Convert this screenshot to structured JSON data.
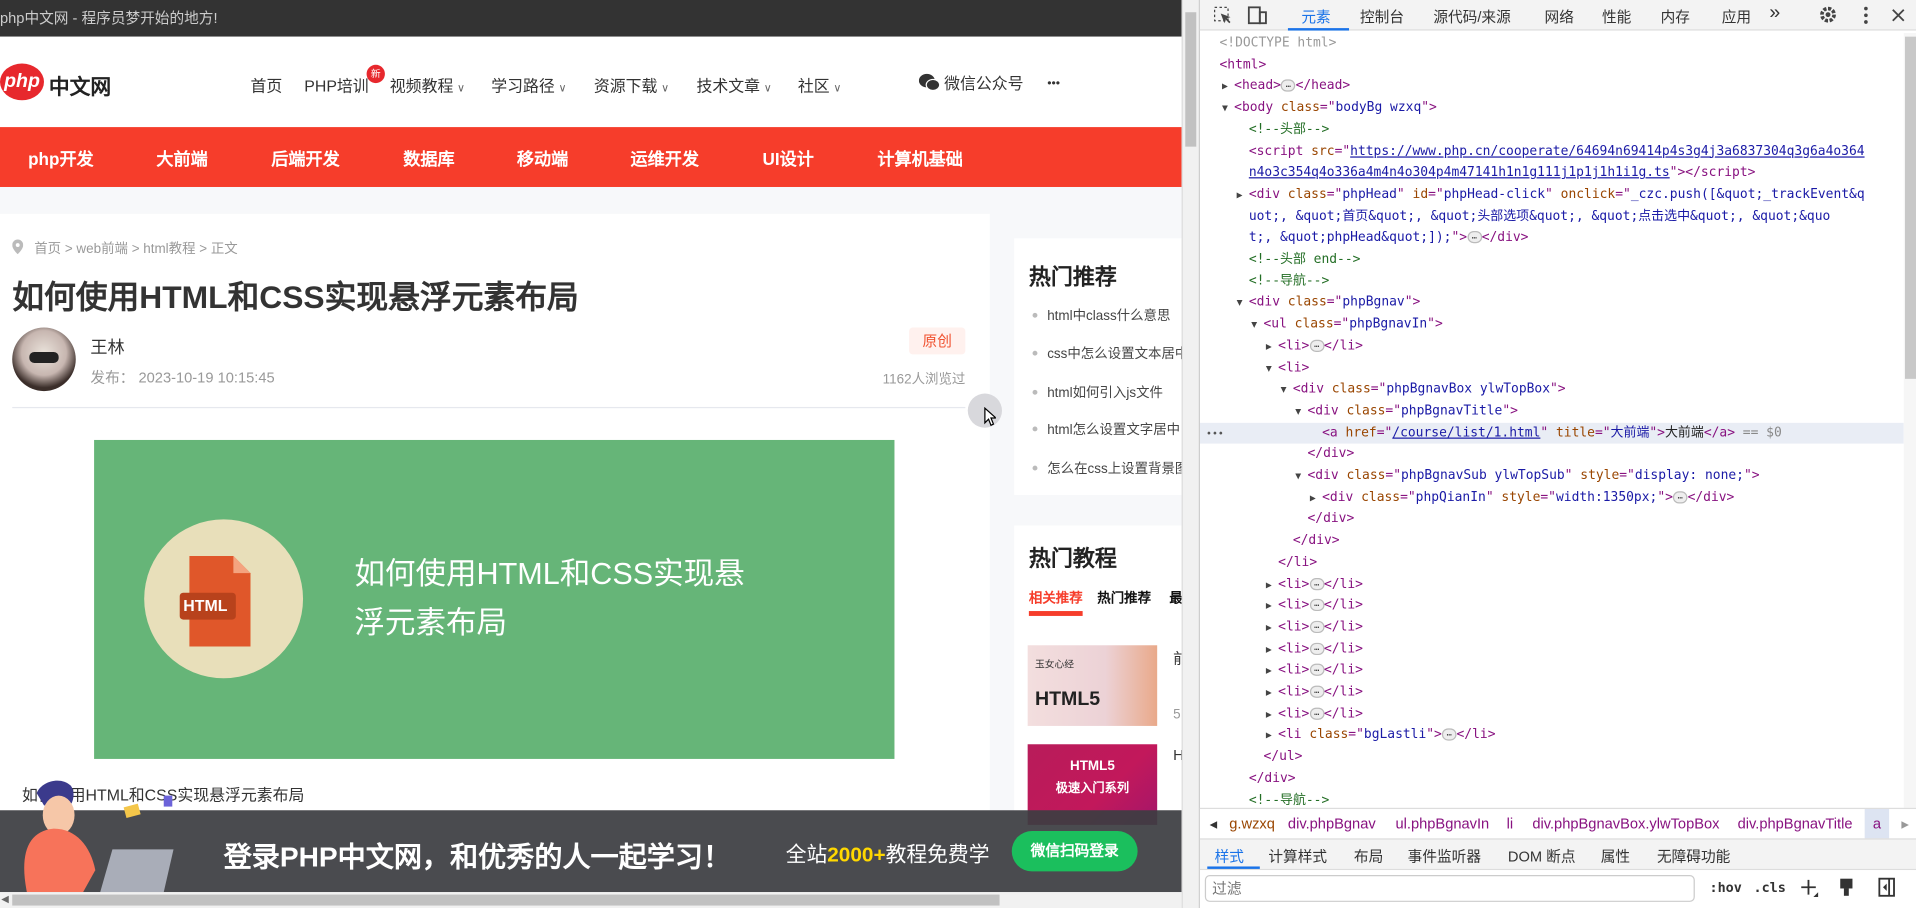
{
  "page": {
    "top_strip": "php中文网 - 程序员梦开始的地方!",
    "logo": {
      "mark": "php",
      "text": "中文网"
    },
    "nav": [
      {
        "label": "首页"
      },
      {
        "label": "PHP培训",
        "badge": "新"
      },
      {
        "label": "视频教程",
        "dropdown": true
      },
      {
        "label": "学习路径",
        "dropdown": true
      },
      {
        "label": "资源下载",
        "dropdown": true
      },
      {
        "label": "技术文章",
        "dropdown": true
      },
      {
        "label": "社区",
        "dropdown": true
      }
    ],
    "wechat": "微信公众号",
    "more": "•••",
    "dropdown_glyph": "∨",
    "category_nav": [
      "php开发",
      "大前端",
      "后端开发",
      "数据库",
      "移动端",
      "运维开发",
      "UI设计",
      "计算机基础"
    ],
    "breadcrumb": "首页 > web前端 > html教程 > 正文",
    "article": {
      "title": "如何使用HTML和CSS实现悬浮元素布局",
      "author": "王林",
      "published": "发布：  2023-10-19 10:15:45",
      "tag": "原创",
      "views": "1162人浏览过",
      "cover": {
        "icon_label": "HTML",
        "line1": "如何使用HTML和CSS实现悬",
        "line2": "浮元素布局"
      },
      "caption": "如何使用HTML和CSS实现悬浮元素布局"
    },
    "hot": {
      "title": "热门推荐",
      "items": [
        "html中class什么意思",
        "css中怎么设置文本居中",
        "html如何引入js文件",
        "html怎么设置文字居中",
        "怎么在css上设置背景图片"
      ]
    },
    "tutorials": {
      "title": "热门教程",
      "tabs": [
        "相关推荐",
        "热门推荐",
        "最"
      ],
      "cards": [
        {
          "thumb_title": "HTML5",
          "thumb_sub": "玉女心经",
          "title": "前",
          "meta": "5"
        },
        {
          "thumb_title": "HTML5",
          "thumb_sub": "极速入门系列",
          "title": "H"
        }
      ]
    },
    "banner": {
      "headline": "登录PHP中文网，和优秀的人一起学习！",
      "sub_pre": "全站",
      "sub_num": "2000+",
      "sub_post": "教程免费学",
      "button": "微信扫码登录"
    },
    "colors": {
      "brand_red": "#f63d2b",
      "green": "#1bbf5d",
      "yellow": "#ffd800"
    }
  },
  "devtools": {
    "tabs": [
      "元素",
      "控制台",
      "源代码/来源",
      "网络",
      "性能",
      "内存",
      "应用"
    ],
    "more_tabs": "»",
    "tree": [
      {
        "i": 0,
        "p": [
          [
            "dt",
            "<!DOCTYPE html>"
          ]
        ]
      },
      {
        "i": 0,
        "p": [
          [
            "tag",
            "<html>"
          ]
        ]
      },
      {
        "i": 1,
        "a": "r",
        "p": [
          [
            "tag",
            "<head>"
          ],
          [
            "ell",
            "…"
          ],
          [
            "tag",
            "</head>"
          ]
        ]
      },
      {
        "i": 1,
        "a": "d",
        "p": [
          [
            "tag",
            "<body "
          ],
          [
            "an",
            "class"
          ],
          [
            "tag",
            "=\""
          ],
          [
            "av",
            "bodyBg wzxq"
          ],
          [
            "tag",
            "\">"
          ]
        ]
      },
      {
        "i": 2,
        "p": [
          [
            "cm",
            "<!--头部-->"
          ]
        ]
      },
      {
        "i": 2,
        "p": [
          [
            "tag",
            "<script "
          ],
          [
            "an",
            "src"
          ],
          [
            "tag",
            "=\""
          ],
          [
            "lk",
            "https://www.php.cn/cooperate/64694n69414p4s3g4j3a6837304q3g6a4o364"
          ]
        ]
      },
      {
        "i": 2,
        "p": [
          [
            "lk",
            "n4o3c354q4o336a4m4n4o304p4m47141h1n1g111j1p1j1h1i1g.ts"
          ],
          [
            "tag",
            "\"></script>"
          ]
        ]
      },
      {
        "i": 2,
        "a": "r",
        "p": [
          [
            "tag",
            "<div "
          ],
          [
            "an",
            "class"
          ],
          [
            "tag",
            "=\""
          ],
          [
            "av",
            "phpHead"
          ],
          [
            "tag",
            "\" "
          ],
          [
            "an",
            "id"
          ],
          [
            "tag",
            "=\""
          ],
          [
            "av",
            "phpHead-click"
          ],
          [
            "tag",
            "\" "
          ],
          [
            "an",
            "onclick"
          ],
          [
            "tag",
            "=\""
          ],
          [
            "av",
            "_czc.push([&quot;_trackEvent&q"
          ]
        ]
      },
      {
        "i": 2,
        "p": [
          [
            "av",
            "uot;, &quot;首页&quot;, &quot;头部选项&quot;, &quot;点击选中&quot;, &quot;&quo"
          ]
        ]
      },
      {
        "i": 2,
        "p": [
          [
            "av",
            "t;, &quot;phpHead&quot;]);"
          ],
          [
            "tag",
            "\">"
          ],
          [
            "ell",
            "…"
          ],
          [
            "tag",
            "</div>"
          ]
        ]
      },
      {
        "i": 2,
        "p": [
          [
            "cm",
            "<!--头部 end-->"
          ]
        ]
      },
      {
        "i": 2,
        "p": [
          [
            "cm",
            "<!--导航-->"
          ]
        ]
      },
      {
        "i": 2,
        "a": "d",
        "p": [
          [
            "tag",
            "<div "
          ],
          [
            "an",
            "class"
          ],
          [
            "tag",
            "=\""
          ],
          [
            "av",
            "phpBgnav"
          ],
          [
            "tag",
            "\">"
          ]
        ]
      },
      {
        "i": 3,
        "a": "d",
        "p": [
          [
            "tag",
            "<ul "
          ],
          [
            "an",
            "class"
          ],
          [
            "tag",
            "=\""
          ],
          [
            "av",
            "phpBgnavIn"
          ],
          [
            "tag",
            "\">"
          ]
        ]
      },
      {
        "i": 4,
        "a": "r",
        "p": [
          [
            "tag",
            "<li>"
          ],
          [
            "ell",
            "…"
          ],
          [
            "tag",
            "</li>"
          ]
        ]
      },
      {
        "i": 4,
        "a": "d",
        "p": [
          [
            "tag",
            "<li>"
          ]
        ]
      },
      {
        "i": 5,
        "a": "d",
        "p": [
          [
            "tag",
            "<div "
          ],
          [
            "an",
            "class"
          ],
          [
            "tag",
            "=\""
          ],
          [
            "av",
            "phpBgnavBox  ylwTopBox"
          ],
          [
            "tag",
            "\">"
          ]
        ]
      },
      {
        "i": 6,
        "a": "d",
        "p": [
          [
            "tag",
            "<div "
          ],
          [
            "an",
            "class"
          ],
          [
            "tag",
            "=\""
          ],
          [
            "av",
            "phpBgnavTitle"
          ],
          [
            "tag",
            "\">"
          ]
        ]
      },
      {
        "i": 7,
        "sel": true,
        "p": [
          [
            "tag",
            "<a "
          ],
          [
            "an",
            "href"
          ],
          [
            "tag",
            "=\""
          ],
          [
            "lk",
            "/course/list/1.html"
          ],
          [
            "tag",
            "\" "
          ],
          [
            "an",
            "title"
          ],
          [
            "tag",
            "=\""
          ],
          [
            "av",
            "大前端"
          ],
          [
            "tag",
            "\">"
          ],
          [
            "tx",
            "大前端"
          ],
          [
            "tag",
            "</a>"
          ],
          [
            "eq",
            " == $0"
          ]
        ]
      },
      {
        "i": 6,
        "p": [
          [
            "tag",
            "</div>"
          ]
        ]
      },
      {
        "i": 6,
        "a": "d",
        "p": [
          [
            "tag",
            "<div "
          ],
          [
            "an",
            "class"
          ],
          [
            "tag",
            "=\""
          ],
          [
            "av",
            "phpBgnavSub  ylwTopSub"
          ],
          [
            "tag",
            "\" "
          ],
          [
            "an",
            "style"
          ],
          [
            "tag",
            "=\""
          ],
          [
            "av",
            "display: none;"
          ],
          [
            "tag",
            "\">"
          ]
        ]
      },
      {
        "i": 7,
        "a": "r",
        "p": [
          [
            "tag",
            "<div "
          ],
          [
            "an",
            "class"
          ],
          [
            "tag",
            "=\""
          ],
          [
            "av",
            "phpQianIn"
          ],
          [
            "tag",
            "\" "
          ],
          [
            "an",
            "style"
          ],
          [
            "tag",
            "=\""
          ],
          [
            "av",
            "width:1350px;"
          ],
          [
            "tag",
            "\">"
          ],
          [
            "ell",
            "…"
          ],
          [
            "tag",
            "</div>"
          ]
        ]
      },
      {
        "i": 6,
        "p": [
          [
            "tag",
            "</div>"
          ]
        ]
      },
      {
        "i": 5,
        "p": [
          [
            "tag",
            "</div>"
          ]
        ]
      },
      {
        "i": 4,
        "p": [
          [
            "tag",
            "</li>"
          ]
        ]
      },
      {
        "i": 4,
        "a": "r",
        "p": [
          [
            "tag",
            "<li>"
          ],
          [
            "ell",
            "…"
          ],
          [
            "tag",
            "</li>"
          ]
        ]
      },
      {
        "i": 4,
        "a": "r",
        "p": [
          [
            "tag",
            "<li>"
          ],
          [
            "ell",
            "…"
          ],
          [
            "tag",
            "</li>"
          ]
        ]
      },
      {
        "i": 4,
        "a": "r",
        "p": [
          [
            "tag",
            "<li>"
          ],
          [
            "ell",
            "…"
          ],
          [
            "tag",
            "</li>"
          ]
        ]
      },
      {
        "i": 4,
        "a": "r",
        "p": [
          [
            "tag",
            "<li>"
          ],
          [
            "ell",
            "…"
          ],
          [
            "tag",
            "</li>"
          ]
        ]
      },
      {
        "i": 4,
        "a": "r",
        "p": [
          [
            "tag",
            "<li>"
          ],
          [
            "ell",
            "…"
          ],
          [
            "tag",
            "</li>"
          ]
        ]
      },
      {
        "i": 4,
        "a": "r",
        "p": [
          [
            "tag",
            "<li>"
          ],
          [
            "ell",
            "…"
          ],
          [
            "tag",
            "</li>"
          ]
        ]
      },
      {
        "i": 4,
        "a": "r",
        "p": [
          [
            "tag",
            "<li>"
          ],
          [
            "ell",
            "…"
          ],
          [
            "tag",
            "</li>"
          ]
        ]
      },
      {
        "i": 4,
        "a": "r",
        "p": [
          [
            "tag",
            "<li "
          ],
          [
            "an",
            "class"
          ],
          [
            "tag",
            "=\""
          ],
          [
            "av",
            "bgLastli"
          ],
          [
            "tag",
            "\">"
          ],
          [
            "ell",
            "…"
          ],
          [
            "tag",
            "</li>"
          ]
        ]
      },
      {
        "i": 3,
        "p": [
          [
            "tag",
            "</ul>"
          ]
        ]
      },
      {
        "i": 2,
        "p": [
          [
            "tag",
            "</div>"
          ]
        ]
      },
      {
        "i": 2,
        "p": [
          [
            "cm",
            "<!--导航-->"
          ]
        ]
      }
    ],
    "selected_gutter": "•••",
    "crumbs": [
      "g.wzxq",
      "div.phpBgnav",
      "ul.phpBgnavIn",
      "li",
      "div.phpBgnavBox.ylwTopBox",
      "div.phpBgnavTitle",
      "a"
    ],
    "style_tabs": [
      "样式",
      "计算样式",
      "布局",
      "事件监听器",
      "DOM 断点",
      "属性",
      "无障碍功能"
    ],
    "filter_placeholder": "过滤",
    "hov": ":hov",
    "cls": ".cls"
  }
}
